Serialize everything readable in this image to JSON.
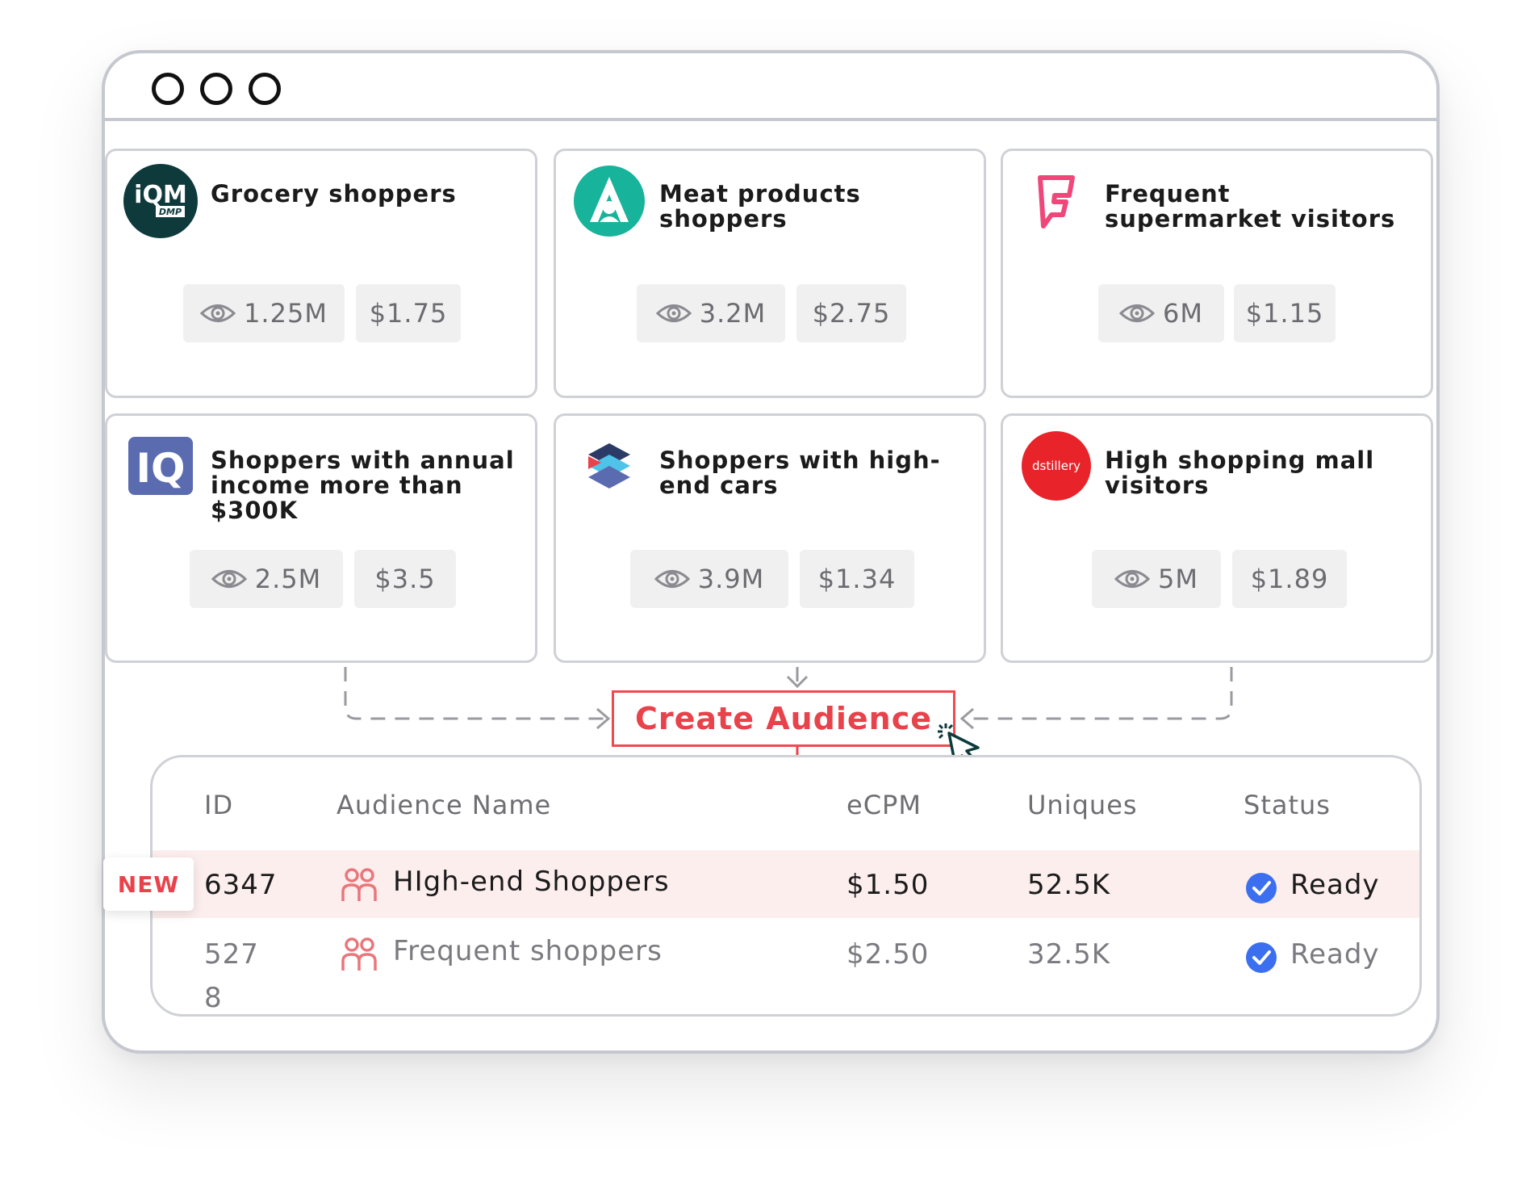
{
  "cards": [
    {
      "title": "Grocery shoppers",
      "uniques": "1.25M",
      "price": "$1.75",
      "logo_text": "iQM",
      "logo_sub": "DMP"
    },
    {
      "title": "Meat products shoppers",
      "uniques": "3.2M",
      "price": "$2.75"
    },
    {
      "title": "Frequent supermarket visitors",
      "uniques": "6M",
      "price": "$1.15"
    },
    {
      "title": "Shoppers with annual income more than $300K",
      "uniques": "2.5M",
      "price": "$3.5",
      "logo_text": "IQ"
    },
    {
      "title": "Shoppers with high-end cars",
      "uniques": "3.9M",
      "price": "$1.34"
    },
    {
      "title": "High shopping mall visitors",
      "uniques": "5M",
      "price": "$1.89",
      "logo_text": "dstillery"
    }
  ],
  "create_button": "Create Audience",
  "table": {
    "headers": {
      "id": "ID",
      "name": "Audience Name",
      "ecpm": "eCPM",
      "uniques": "Uniques",
      "status": "Status"
    },
    "rows": [
      {
        "id": "6347",
        "name": "HIgh-end Shoppers",
        "ecpm": "$1.50",
        "uniques": "52.5K",
        "status": "Ready",
        "badge": "NEW"
      },
      {
        "id_line1": "527",
        "id_line2": "8",
        "name": "Frequent shoppers",
        "ecpm": "$2.50",
        "uniques": "32.5K",
        "status": "Ready"
      }
    ]
  },
  "colors": {
    "accent": "#e8424a",
    "check": "#3b6ff0",
    "teal": "#17b39a",
    "iq_blue": "#5b6bb0",
    "dstillery": "#e8232a",
    "foursquare": "#f0477a"
  },
  "icons": [
    "eye-icon",
    "people-icon",
    "check-circle-icon",
    "cursor-icon"
  ]
}
